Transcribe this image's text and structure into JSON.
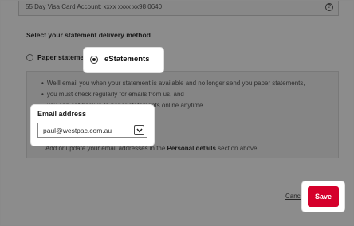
{
  "account": {
    "text": "55 Day Visa Card Account: xxxx xxxx xx98 0640",
    "help_icon": "?"
  },
  "delivery": {
    "section_title": "Select your statement delivery method",
    "options": [
      {
        "label": "Paper statements",
        "selected": false
      },
      {
        "label": "eStatements",
        "selected": true
      }
    ]
  },
  "info": {
    "bullets": [
      "We'll email you when your statement is available and no longer send you paper statements,",
      "you must check regularly for emails from us, and",
      "you can opt back in to paper statements online anytime."
    ],
    "update_note_prefix": "Add or update your email addresses in the ",
    "update_note_bold": "Personal details",
    "update_note_suffix": " section above"
  },
  "email": {
    "label": "Email address",
    "selected_value": "paul@westpac.com.au"
  },
  "actions": {
    "cancel_label": "Cancel",
    "save_label": "Save"
  },
  "colors": {
    "save_button": "#d5002b",
    "overlay": "rgba(0,0,0,0.45)"
  }
}
